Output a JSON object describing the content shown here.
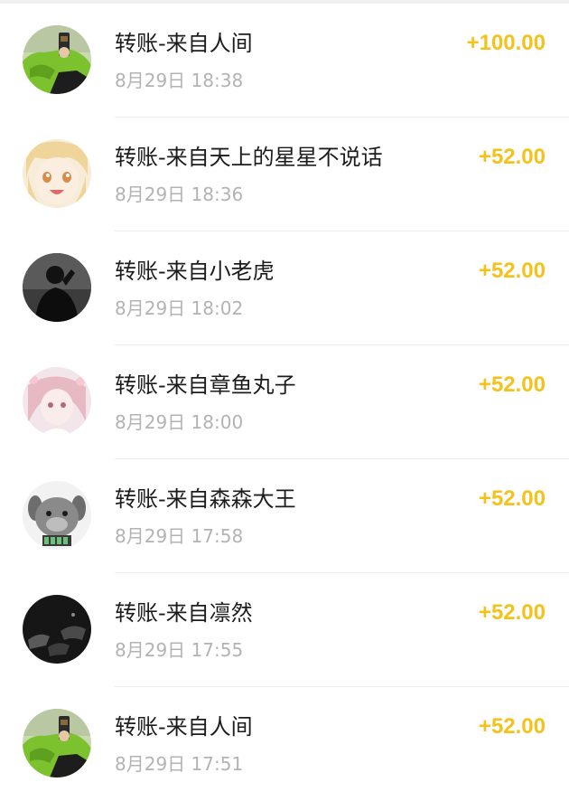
{
  "transactions": [
    {
      "title": "转账-来自人间",
      "time": "8月29日 18:38",
      "amount": "+100.00",
      "avatar_icon": "green-hoodie-selfie-avatar"
    },
    {
      "title": "转账-来自天上的星星不说话",
      "time": "8月29日 18:36",
      "amount": "+52.00",
      "avatar_icon": "anime-girl-avatar"
    },
    {
      "title": "转账-来自小老虎",
      "time": "8月29日 18:02",
      "amount": "+52.00",
      "avatar_icon": "silhouette-avatar"
    },
    {
      "title": "转账-来自章鱼丸子",
      "time": "8月29日 18:00",
      "amount": "+52.00",
      "avatar_icon": "pink-anime-avatar"
    },
    {
      "title": "转账-来自森森大王",
      "time": "8月29日 17:58",
      "amount": "+52.00",
      "avatar_icon": "grey-puppy-avatar"
    },
    {
      "title": "转账-来自凛然",
      "time": "8月29日 17:55",
      "amount": "+52.00",
      "avatar_icon": "dark-hands-avatar"
    },
    {
      "title": "转账-来自人间",
      "time": "8月29日 17:51",
      "amount": "+52.00",
      "avatar_icon": "green-hoodie-selfie-avatar"
    }
  ],
  "colors": {
    "amount": "#f4c21b",
    "title": "#1c1c1c",
    "time": "#b3b3b3"
  }
}
